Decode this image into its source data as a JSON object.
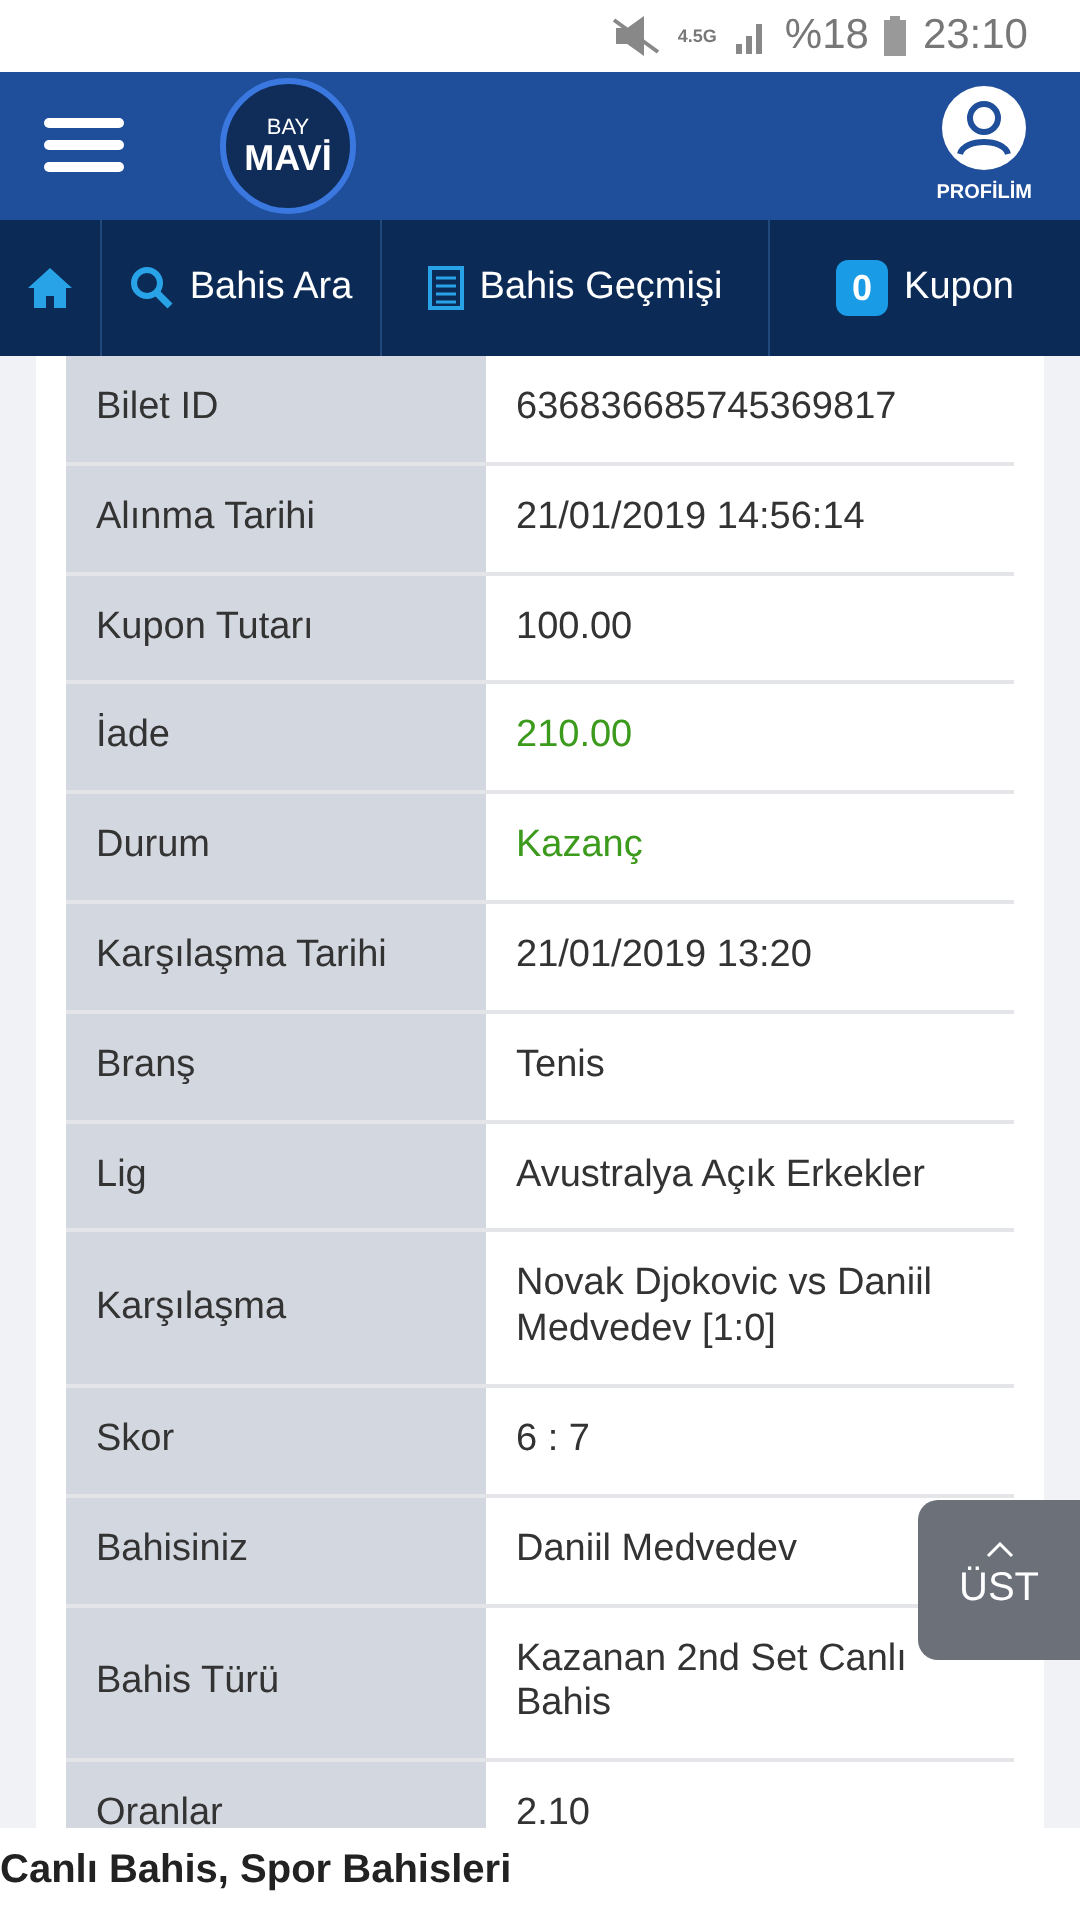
{
  "status_bar": {
    "network": "4.5G",
    "battery": "%18",
    "time": "23:10"
  },
  "header": {
    "logo_top": "BAY",
    "logo_bottom": "MAVİ",
    "profile_label": "PROFİLİM"
  },
  "nav": [
    {
      "kind": "home"
    },
    {
      "kind": "search",
      "label": "Bahis Ara"
    },
    {
      "kind": "list",
      "label": "Bahis Geçmişi"
    },
    {
      "kind": "badge",
      "badge": "0",
      "label": "Kupon"
    }
  ],
  "details": [
    {
      "label": "Bilet ID",
      "value": "636836685745369817"
    },
    {
      "label": "Alınma Tarihi",
      "value": "21/01/2019 14:56:14"
    },
    {
      "label": "Kupon Tutarı",
      "value": "100.00"
    },
    {
      "label": "İade",
      "value": "210.00",
      "color": "#3c9a1c"
    },
    {
      "label": "Durum",
      "value": "Kazanç",
      "color": "#3c9a1c"
    },
    {
      "label": "Karşılaşma Tarihi",
      "value": "21/01/2019 13:20"
    },
    {
      "label": "Branş",
      "value": "Tenis"
    },
    {
      "label": "Lig",
      "value": "Avustralya Açık Erkekler"
    },
    {
      "label": "Karşılaşma",
      "value": "Novak Djokovic vs Daniil Medvedev [1:0]"
    },
    {
      "label": "Skor",
      "value": "6 : 7"
    },
    {
      "label": "Bahisiniz",
      "value": "Daniil Medvedev"
    },
    {
      "label": "Bahis Türü",
      "value": "Kazanan 2nd Set Canlı Bahis"
    },
    {
      "label": "Oranlar",
      "value": "2.10"
    }
  ],
  "scroll_top_button": {
    "label": "ÜST"
  },
  "footer": {
    "text": "Canlı Bahis, Spor Bahisleri"
  }
}
